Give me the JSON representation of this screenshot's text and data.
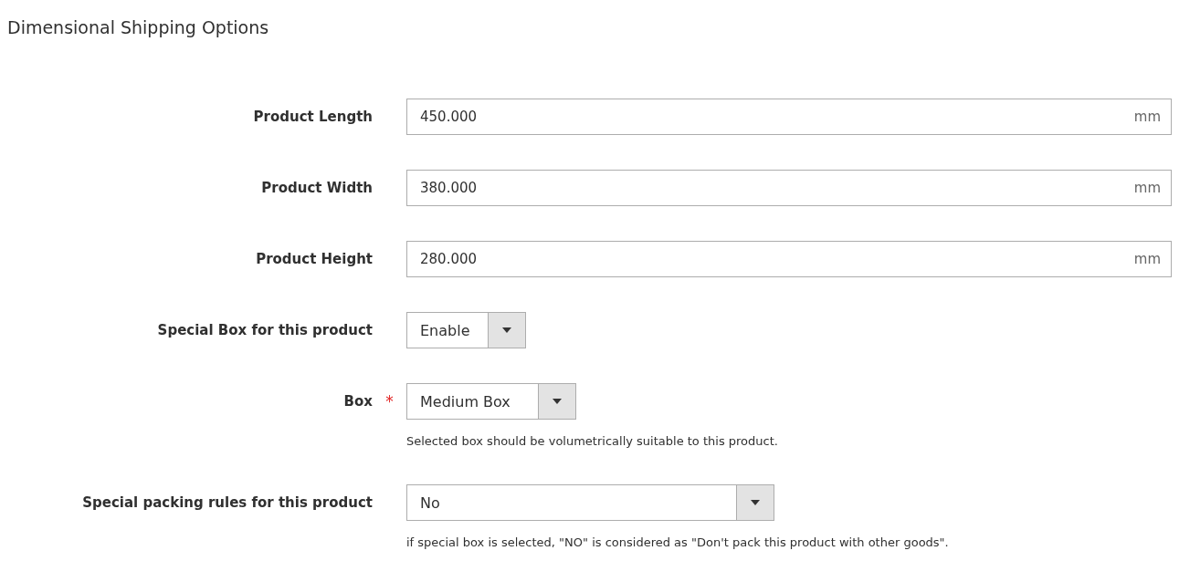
{
  "section": {
    "title": "Dimensional Shipping Options"
  },
  "fields": [
    {
      "kind": "text",
      "label": "Product Length",
      "value": "450.000",
      "unit": "mm"
    },
    {
      "kind": "text",
      "label": "Product Width",
      "value": "380.000",
      "unit": "mm"
    },
    {
      "kind": "text",
      "label": "Product Height",
      "value": "280.000",
      "unit": "mm"
    },
    {
      "kind": "select",
      "label": "Special Box for this product",
      "value": "Enable"
    },
    {
      "kind": "select",
      "label": "Box",
      "required_mark": "*",
      "value": "Medium Box",
      "note": "Selected box should be volumetrically suitable to this product."
    },
    {
      "kind": "select",
      "label": "Special packing rules for this product",
      "value": "No",
      "note": "if special box is selected, \"NO\" is considered as \"Don't pack this product with other goods\"."
    }
  ]
}
